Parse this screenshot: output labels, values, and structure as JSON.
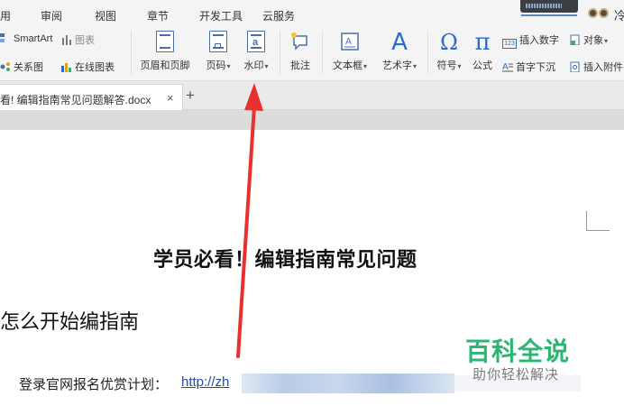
{
  "menu_tabs": [
    "用",
    "审阅",
    "视图",
    "章节",
    "开发工具",
    "云服务"
  ],
  "menu_cut_letter": "冷",
  "ribbon": {
    "smartart": "SmartArt",
    "chart": "图表",
    "relation_chart": "关系图",
    "online_chart": "在线图表",
    "header_footer": "页眉和页脚",
    "page_number": "页码",
    "watermark": "水印",
    "comment": "批注",
    "textbox": "文本框",
    "wordart": "艺术字",
    "symbol": "符号",
    "formula": "公式",
    "insert_number": "插入数字",
    "drop_cap": "首字下沉",
    "object": "对象",
    "insert_attachment": "插入附件",
    "dropdown_glyph": "▾",
    "icon_a": "A",
    "icon_omega": "Ω",
    "icon_pi": "π",
    "icon_123": "123"
  },
  "document_tab": {
    "label": "看! 编辑指南常见问题解答.docx",
    "close": "×",
    "add": "+"
  },
  "document": {
    "title": "学员必看！编辑指南常见问题",
    "heading": "怎么开始编指南",
    "paragraph": "登录官网报名优赏计划：",
    "link": "http://zh"
  },
  "watermark_logo": {
    "main": "百科全说",
    "sub": "助你轻松解决"
  },
  "colors": {
    "accent_blue": "#4a6fa5",
    "link_blue": "#1f4ea8",
    "watermark_green": "#2bb673",
    "arrow_red": "#e8312f"
  }
}
